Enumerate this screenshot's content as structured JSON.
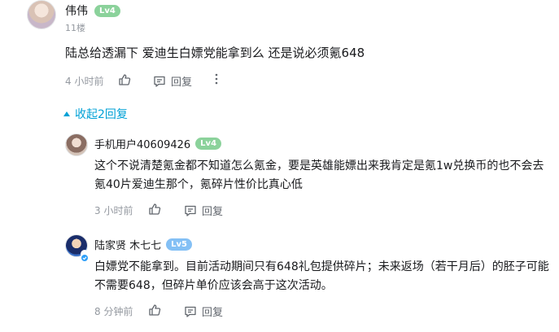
{
  "main_comment": {
    "user": "伟伟",
    "level": "Lv4",
    "floor": "11楼",
    "text": "陆总给透漏下 爱迪生白嫖党能拿到么 还是说必须氪648",
    "time": "4 小时前",
    "reply_label": "回复"
  },
  "collapse_label": "收起2回复",
  "replies": [
    {
      "user": "手机用户40609426",
      "level": "Lv4",
      "line1": "这个不说清楚氪金都不知道怎么氪金，要是英雄能嫖出来我肯定是氪1w兑换币的也不会去",
      "line2": "氪40片爱迪生那个，氪碎片性价比真心低",
      "time": "3 小时前",
      "reply_label": "回复"
    },
    {
      "user": "陆家贤 木七七",
      "level": "Lv5",
      "line1": "白嫖党不能拿到。目前活动期间只有648礼包提供碎片；未来返场（若干月后）的胚子可能",
      "line2": "不需要648，但碎片单价应该会高于这次活动。",
      "time": "8 分钟前",
      "reply_label": "回复"
    }
  ],
  "icons": {
    "like": "thumbs-up-icon",
    "reply": "comment-icon",
    "more": "more-vertical-icon",
    "collapse": "triangle-up-icon",
    "verified": "verified-badge-icon"
  },
  "colors": {
    "accent": "#00a1d6",
    "lv_green": "#8bd29b",
    "lv_blue": "#84c0f5",
    "muted": "#9499a0"
  }
}
